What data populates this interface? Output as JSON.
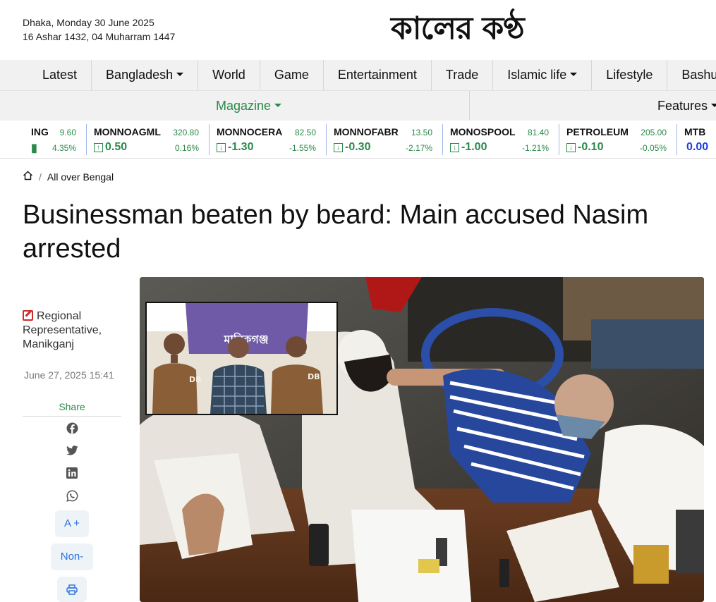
{
  "header": {
    "date_line1": "Dhaka, Monday 30 June 2025",
    "date_line2": "16 Ashar 1432, 04 Muharram 1447",
    "logo_text": "কালের কণ্ঠ"
  },
  "nav": {
    "items": [
      {
        "label": "Latest",
        "dropdown": false
      },
      {
        "label": "Bangladesh",
        "dropdown": true
      },
      {
        "label": "World",
        "dropdown": false
      },
      {
        "label": "Game",
        "dropdown": false
      },
      {
        "label": "Entertainment",
        "dropdown": false
      },
      {
        "label": "Trade",
        "dropdown": false
      },
      {
        "label": "Islamic life",
        "dropdown": true
      },
      {
        "label": "Lifestyle",
        "dropdown": false
      },
      {
        "label": "Bashu",
        "dropdown": false
      }
    ],
    "magazine_label": "Magazine",
    "features_label": "Features"
  },
  "ticker": [
    {
      "name": "ING",
      "price": "9.60",
      "change": "",
      "pct": "4.35%",
      "direction": ""
    },
    {
      "name": "MONNOAGML",
      "price": "320.80",
      "change": "0.50",
      "pct": "0.16%",
      "direction": "up"
    },
    {
      "name": "MONNOCERA",
      "price": "82.50",
      "change": "-1.30",
      "pct": "-1.55%",
      "direction": "down"
    },
    {
      "name": "MONNOFABR",
      "price": "13.50",
      "change": "-0.30",
      "pct": "-2.17%",
      "direction": "down"
    },
    {
      "name": "MONOSPOOL",
      "price": "81.40",
      "change": "-1.00",
      "pct": "-1.21%",
      "direction": "down"
    },
    {
      "name": "PETROLEUM",
      "price": "205.00",
      "change": "-0.10",
      "pct": "-0.05%",
      "direction": "down"
    },
    {
      "name": "MTB",
      "price": "",
      "change": "0.00",
      "pct": "",
      "direction": "flat"
    }
  ],
  "breadcrumb": {
    "section": "All over Bengal"
  },
  "article": {
    "headline": "Businessman beaten by beard: Main accused Nasim arrested",
    "author": "Regional Representative, Manikganj",
    "timestamp": "June 27, 2025 15:41",
    "image_inset_banner_text": "মানিকগঞ্জ",
    "vest_text": "DB"
  },
  "share": {
    "label": "Share",
    "font_increase": "A +",
    "non_label": "Non-"
  },
  "colors": {
    "green": "#2a8a4a",
    "blue": "#1a3fe0",
    "nav_bg": "#f1f1f1",
    "edit_red": "#d12a2a"
  }
}
